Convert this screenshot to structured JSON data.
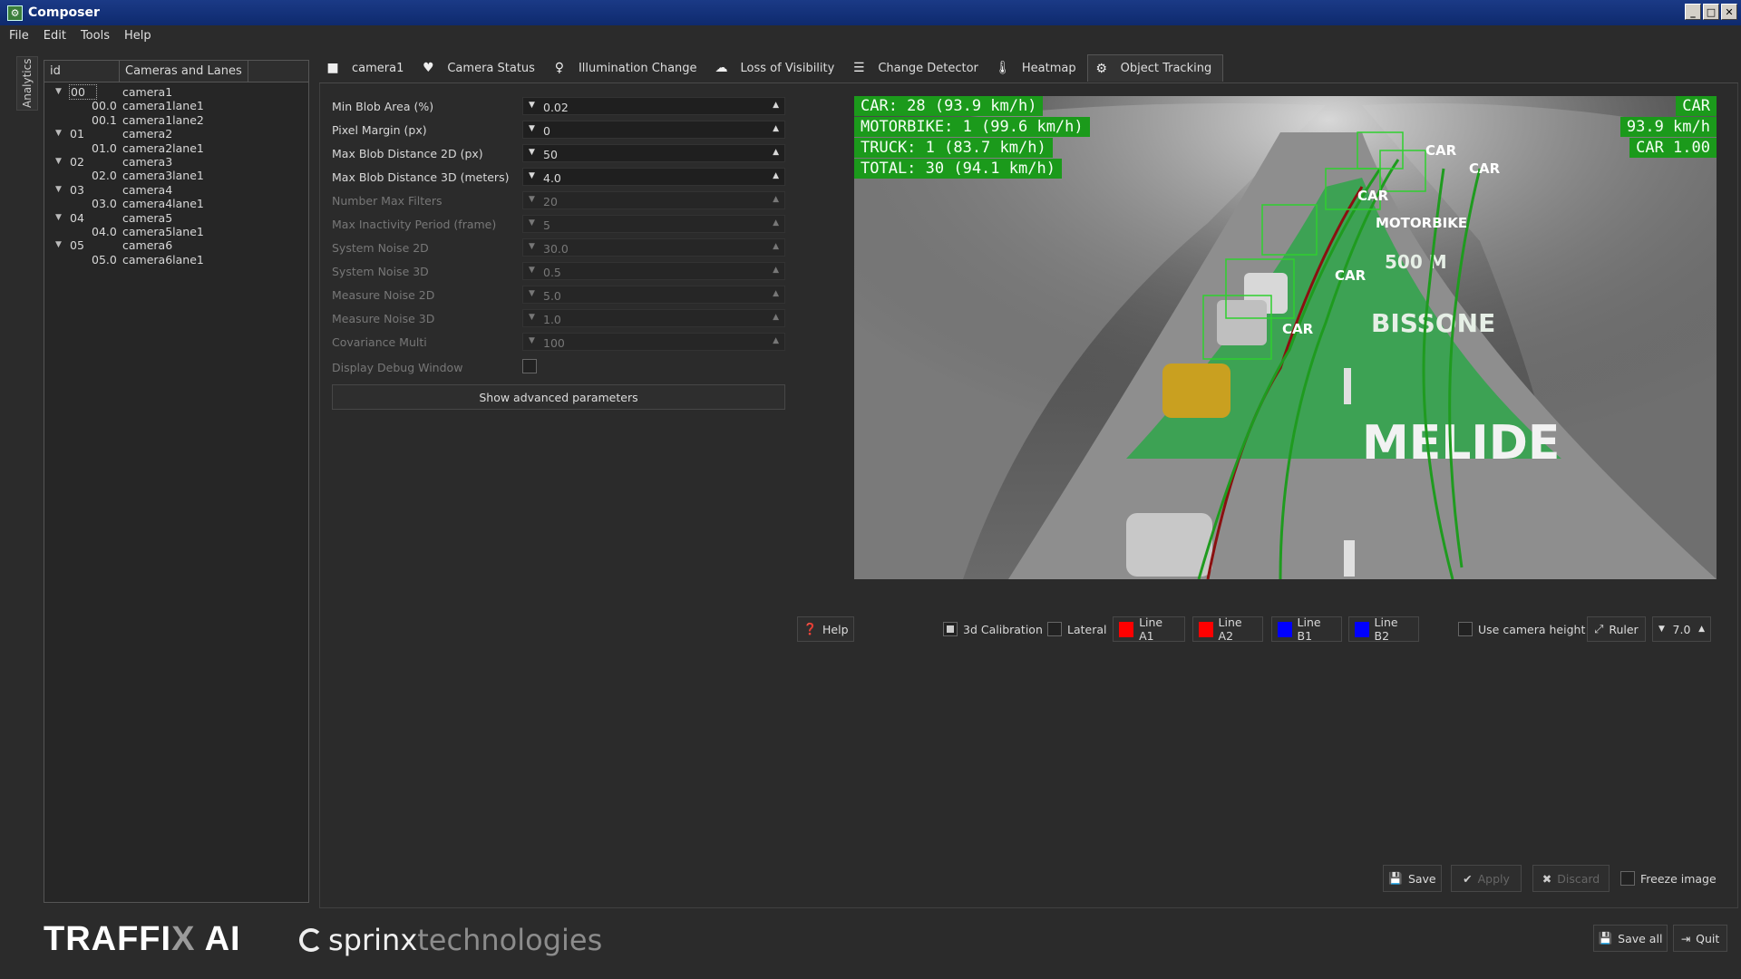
{
  "window": {
    "title": "Composer"
  },
  "menu": [
    "File",
    "Edit",
    "Tools",
    "Help"
  ],
  "side_tab": "Analytics",
  "tree": {
    "headers": [
      "id",
      "Cameras and Lanes"
    ],
    "rows": [
      {
        "id": "00",
        "name": "camera1",
        "kind": "camera"
      },
      {
        "id": "00.0",
        "name": "camera1lane1",
        "kind": "lane"
      },
      {
        "id": "00.1",
        "name": "camera1lane2",
        "kind": "lane"
      },
      {
        "id": "01",
        "name": "camera2",
        "kind": "camera"
      },
      {
        "id": "01.0",
        "name": "camera2lane1",
        "kind": "lane"
      },
      {
        "id": "02",
        "name": "camera3",
        "kind": "camera"
      },
      {
        "id": "02.0",
        "name": "camera3lane1",
        "kind": "lane"
      },
      {
        "id": "03",
        "name": "camera4",
        "kind": "camera"
      },
      {
        "id": "03.0",
        "name": "camera4lane1",
        "kind": "lane"
      },
      {
        "id": "04",
        "name": "camera5",
        "kind": "camera"
      },
      {
        "id": "04.0",
        "name": "camera5lane1",
        "kind": "lane"
      },
      {
        "id": "05",
        "name": "camera6",
        "kind": "camera"
      },
      {
        "id": "05.0",
        "name": "camera6lane1",
        "kind": "lane"
      }
    ]
  },
  "tabs": [
    {
      "label": "camera1",
      "icon": "video-camera-icon"
    },
    {
      "label": "Camera Status",
      "icon": "heartbeat-icon"
    },
    {
      "label": "Illumination Change",
      "icon": "lightbulb-icon"
    },
    {
      "label": "Loss of Visibility",
      "icon": "cloud-icon"
    },
    {
      "label": "Change Detector",
      "icon": "sliders-icon"
    },
    {
      "label": "Heatmap",
      "icon": "thermometer-icon"
    },
    {
      "label": "Object Tracking",
      "icon": "gears-icon",
      "active": true
    }
  ],
  "params": [
    {
      "label": "Min Blob Area  (%)",
      "value": "0.02",
      "enabled": true
    },
    {
      "label": "Pixel Margin  (px)",
      "value": "0",
      "enabled": true
    },
    {
      "label": "Max Blob Distance 2D  (px)",
      "value": "50",
      "enabled": true
    },
    {
      "label": "Max Blob Distance 3D  (meters)",
      "value": "4.0",
      "enabled": true
    },
    {
      "label": "Number Max Filters",
      "value": "20",
      "enabled": false
    },
    {
      "label": "Max Inactivity Period  (frame)",
      "value": "5",
      "enabled": false
    },
    {
      "label": "System Noise 2D",
      "value": "30.0",
      "enabled": false
    },
    {
      "label": "System Noise 3D",
      "value": "0.5",
      "enabled": false
    },
    {
      "label": "Measure Noise 2D",
      "value": "5.0",
      "enabled": false
    },
    {
      "label": "Measure Noise 3D",
      "value": "1.0",
      "enabled": false
    },
    {
      "label": "Covariance Multi",
      "value": "100",
      "enabled": false
    }
  ],
  "debug": {
    "label": "Display Debug Window",
    "checked": false
  },
  "advanced_button": "Show advanced parameters",
  "overlay": {
    "stats": [
      "CAR: 28 (93.9 km/h)",
      "MOTORBIKE: 1 (99.6 km/h)",
      "TRUCK: 1 (83.7 km/h)",
      "TOTAL: 30 (94.1 km/h)"
    ],
    "last": [
      "CAR",
      "93.9 km/h",
      "CAR 1.00"
    ],
    "object_labels": [
      "CAR",
      "CAR",
      "CAR",
      "MOTORBIKE",
      "CAR",
      "CAR"
    ],
    "road_text": [
      "500 M",
      "BISSONE",
      "MELIDE"
    ],
    "box_color": "#2fd02f"
  },
  "controls": {
    "help": "Help",
    "calibration": {
      "label": "3d Calibration",
      "checked": true
    },
    "lateral": {
      "label": "Lateral",
      "checked": false
    },
    "lines": [
      {
        "label": "Line A1",
        "color": "#ff0000"
      },
      {
        "label": "Line A2",
        "color": "#ff0000"
      },
      {
        "label": "Line B1",
        "color": "#0000ff"
      },
      {
        "label": "Line B2",
        "color": "#0000ff"
      }
    ],
    "use_camera_height": {
      "label": "Use camera height",
      "checked": false
    },
    "ruler": "Ruler",
    "ruler_value": "7.0"
  },
  "actions": {
    "save": "Save",
    "apply": "Apply",
    "discard": "Discard",
    "freeze": {
      "label": "Freeze image",
      "checked": false
    },
    "save_all": "Save all",
    "quit": "Quit"
  },
  "footer": {
    "brand_pre": "TRAFFI",
    "brand_x": "X",
    "brand_post": " AI",
    "sprinx": "sprinx",
    "technologies": "technologies"
  }
}
